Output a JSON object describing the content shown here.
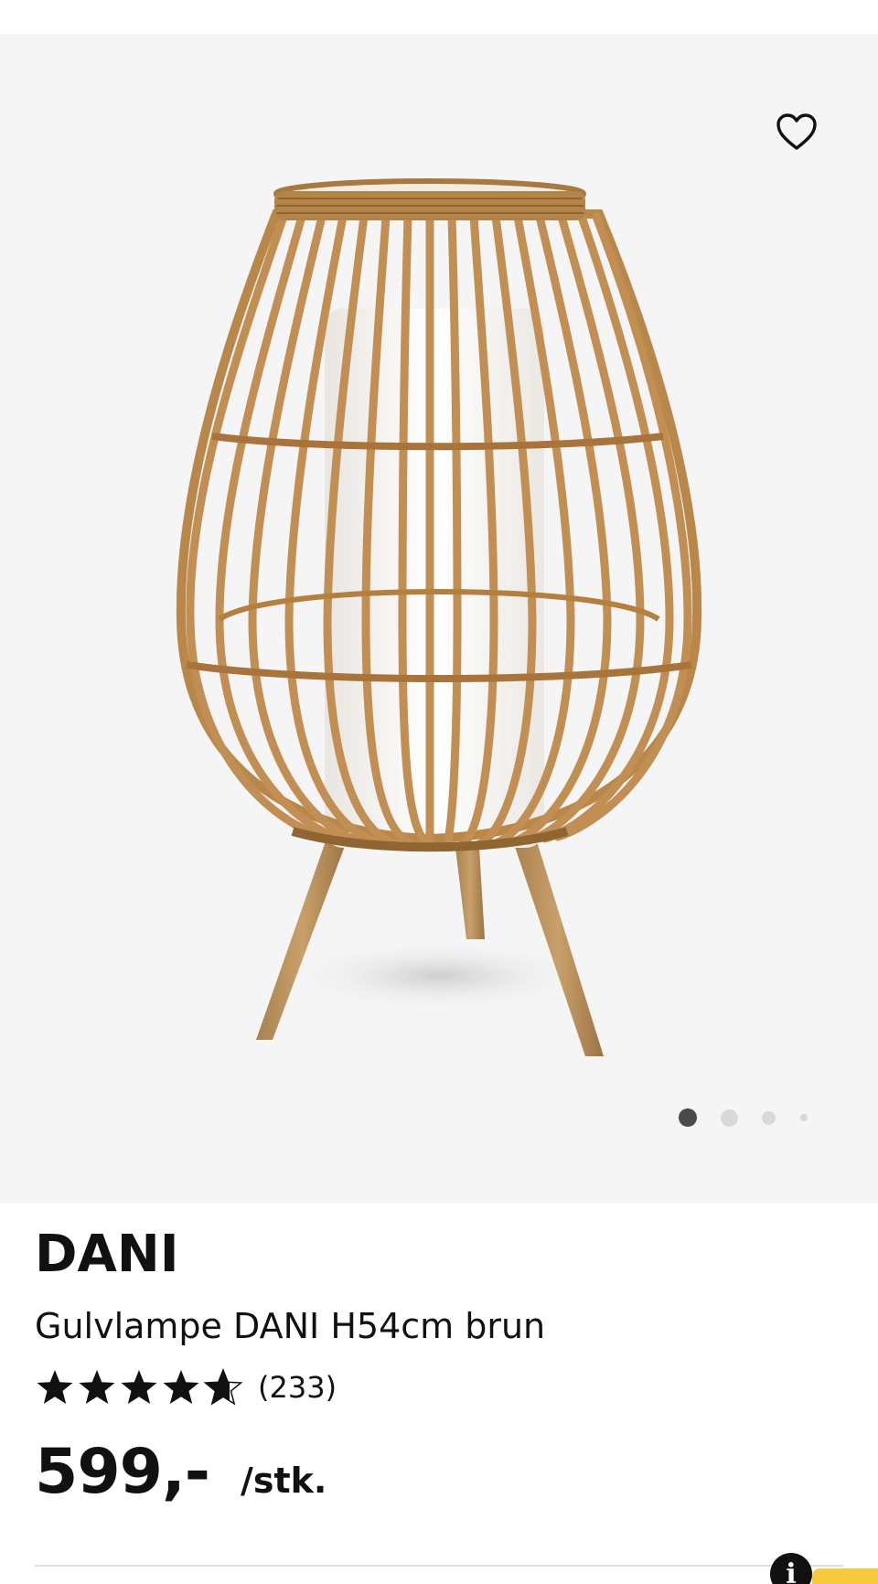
{
  "product": {
    "brand": "DANI",
    "description": "Gulvlampe DANI H54cm brun",
    "rating_value": 4.5,
    "rating_max": 5,
    "review_count": "(233)",
    "price": "599,-",
    "unit": "/stk."
  },
  "gallery": {
    "image_count": 4,
    "active_index": 0
  },
  "icons": {
    "favorite": "heart-outline-icon",
    "info": "info-icon",
    "star": "star-icon"
  },
  "info_button": {
    "label": "i"
  },
  "colors": {
    "gallery_background": "#f5f5f5",
    "text": "#111111",
    "dot_active": "#4a4a4a",
    "dot_inactive": "#d9d9d9",
    "accent_yellow": "#f7c93c"
  }
}
